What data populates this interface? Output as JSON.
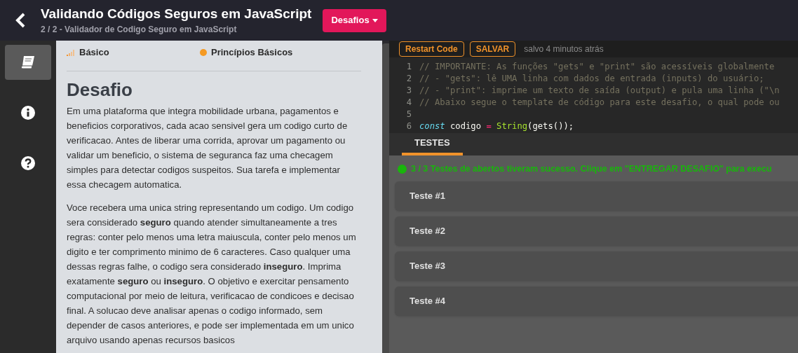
{
  "header": {
    "title": "Validando Códigos Seguros em JavaScript",
    "subtitle": "2 / 2 - Validador de Codigo Seguro em JavaScript",
    "menu_button": "Desafios"
  },
  "sidebar": {
    "items": [
      {
        "selected": true
      },
      {
        "selected": false
      },
      {
        "selected": false
      }
    ]
  },
  "challenge": {
    "level": "Básico",
    "topic": "Princípios Básicos",
    "heading": "Desafio",
    "paragraphs": [
      "Em uma plataforma que integra mobilidade urbana, pagamentos e beneficios corporativos, cada acao sensivel gera um codigo curto de verificacao. Antes de liberar uma corrida, aprovar um pagamento ou validar um beneficio, o sistema de seguranca faz uma checagem simples para detectar codigos suspeitos. Sua tarefa e implementar essa checagem automatica.",
      "Voce recebera uma unica string representando um codigo. Um codigo sera considerado **seguro** quando atender simultaneamente a tres regras: conter pelo menos uma letra maiuscula, conter pelo menos um digito e ter comprimento minimo de 6 caracteres. Caso qualquer uma dessas regras falhe, o codigo sera considerado **inseguro**. Imprima exatamente **seguro** ou **inseguro**. O objetivo e exercitar pensamento computacional por meio de leitura, verificacao de condicoes e decisao final. A solucao deve analisar apenas o codigo informado, sem depender de casos anteriores, e pode ser implementada em um unico arquivo usando apenas recursos basicos"
    ]
  },
  "editor": {
    "buttons": [
      "Restart Code",
      "SALVAR"
    ],
    "saved_status": "salvo 4 minutos atrás",
    "lines": [
      {
        "number": "1",
        "tokens": [
          {
            "kind": "comment",
            "text": "// IMPORTANTE: As funções \"gets\" e \"print\" são acessíveis globalmente"
          }
        ]
      },
      {
        "number": "2",
        "tokens": [
          {
            "kind": "comment",
            "text": "// - \"gets\": lê UMA linha com dados de entrada (inputs) do usuário;"
          }
        ]
      },
      {
        "number": "3",
        "tokens": [
          {
            "kind": "comment",
            "text": "// - \"print\": imprime um texto de saída (output) e pula uma linha (\"\\n"
          }
        ]
      },
      {
        "number": "4",
        "tokens": [
          {
            "kind": "comment",
            "text": "// Abaixo segue o template de código para este desafio, o qual pode ou"
          }
        ]
      },
      {
        "number": "5"
      },
      {
        "number": "6",
        "tokens": [
          {
            "kind": "keyword",
            "text": "const"
          },
          {
            "kind": "plain",
            "text": " codigo "
          },
          {
            "kind": "operator",
            "text": "="
          },
          {
            "kind": "function",
            "text": " String"
          },
          {
            "kind": "plain",
            "text": "(gets());"
          }
        ]
      }
    ]
  },
  "tabs": [
    {
      "label": "TESTES",
      "selected": true
    }
  ],
  "result": {
    "passed": true,
    "message": "3 / 3 Testes de abertos tiveram sucesso. Clique em \"ENTREGAR DESAFIO\" para execu"
  },
  "tests": [
    "Teste #1",
    "Teste #2",
    "Teste #3",
    "Teste #4"
  ]
}
